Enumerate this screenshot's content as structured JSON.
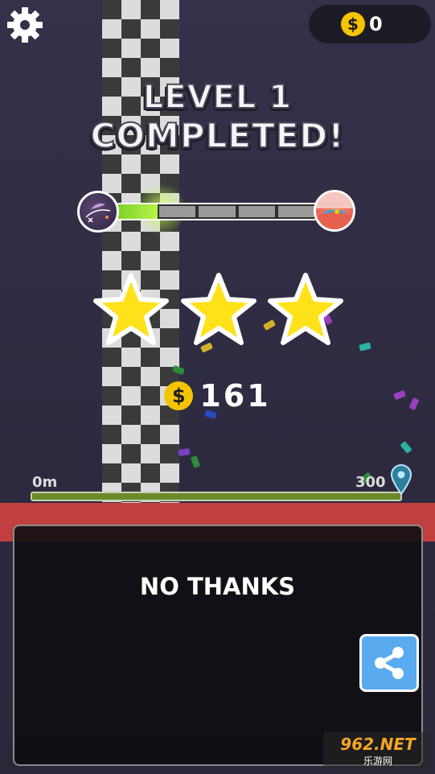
{
  "hud": {
    "coin_symbol": "$",
    "coin_count": "0"
  },
  "title": {
    "line1": "LEVEL 1",
    "line2": "COMPLETED!"
  },
  "level_progress": {
    "fraction": 0.2,
    "segments": 5
  },
  "stars": {
    "earned": 3,
    "total": 3
  },
  "reward": {
    "coin_symbol": "$",
    "amount": "161"
  },
  "distance": {
    "start_label": "0m",
    "end_label": "300"
  },
  "panel": {
    "no_thanks_label": "NO THANKS"
  },
  "watermark": {
    "top": "962.NET",
    "bottom": "乐游网"
  },
  "colors": {
    "coin": "#f5c400",
    "star": "#ffe21a",
    "progress": "#8bdb32",
    "share": "#5aaaf0",
    "band": "#c13f3f"
  },
  "icons": [
    "gear-icon",
    "coin-icon",
    "star-icon",
    "share-icon",
    "location-pin-icon"
  ]
}
